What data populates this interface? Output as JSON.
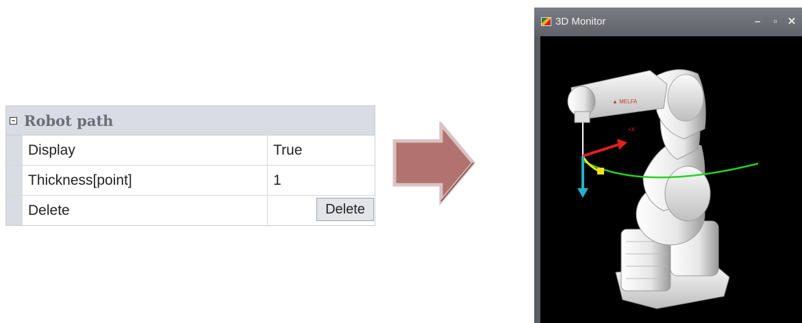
{
  "property_grid": {
    "section_title": "Robot path",
    "rows": [
      {
        "name": "Display",
        "value": "True"
      },
      {
        "name": "Thickness[point]",
        "value": "1"
      },
      {
        "name": "Delete",
        "value": "",
        "button_label": "Delete"
      }
    ]
  },
  "monitor": {
    "title": "3D Monitor",
    "buttons": [
      "minimize",
      "maximize",
      "close"
    ]
  },
  "colors": {
    "arrow": "#b27270",
    "path_line": "#23d41f",
    "axis_x": "#e02020",
    "axis_z": "#22b3c9",
    "robot": "#f2f2f2",
    "background": "#000000"
  }
}
